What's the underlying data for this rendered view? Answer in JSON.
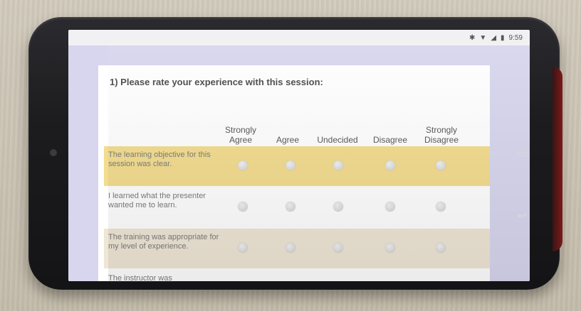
{
  "status_bar": {
    "icons": [
      "bluetooth-icon",
      "wifi-icon",
      "signal-icon",
      "battery-icon"
    ],
    "time": "9:59"
  },
  "survey": {
    "question": "1) Please rate your experience with this session:",
    "columns": [
      "Strongly Agree",
      "Agree",
      "Undecided",
      "Disagree",
      "Strongly Disagree"
    ],
    "rows": [
      {
        "label": "The learning objective for this session was clear.",
        "highlight": "#f3dc8e"
      },
      {
        "label": "I learned what the presenter wanted me to learn.",
        "highlight": "#ffffff"
      },
      {
        "label": "The training was appropriate for my level of experience.",
        "highlight": "#efe6d5"
      },
      {
        "label": "The instructor was",
        "highlight": "#ffffff"
      }
    ]
  },
  "colors": {
    "app_background": "#d7d6ee",
    "row_highlight_1": "#f3dc8e",
    "row_highlight_3": "#efe6d5",
    "phone_body": "#1c1c1f",
    "phone_accent": "#7c1a1a"
  },
  "nav_keys": [
    "recent-apps-icon",
    "home-icon",
    "back-icon"
  ]
}
